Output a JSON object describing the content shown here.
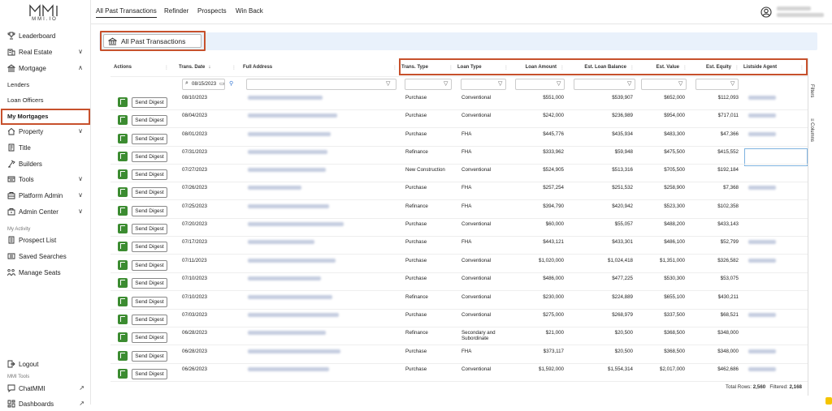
{
  "brand": {
    "logo_text": "MMI.IO"
  },
  "sidebar": {
    "items": [
      {
        "label": "Leaderboard",
        "icon": "trophy-icon",
        "has_chevron": false
      },
      {
        "label": "Real Estate",
        "icon": "building-icon",
        "has_chevron": true,
        "chevron": "∨"
      },
      {
        "label": "Mortgage",
        "icon": "bank-icon",
        "has_chevron": true,
        "chevron": "∧"
      },
      {
        "label": "Lenders",
        "sub": true
      },
      {
        "label": "Loan Officers",
        "sub": true
      },
      {
        "label": "My Mortgages",
        "sub": true,
        "highlighted": true
      },
      {
        "label": "Property",
        "icon": "house-icon",
        "has_chevron": true,
        "chevron": "∨"
      },
      {
        "label": "Title",
        "icon": "title-icon",
        "has_chevron": false
      },
      {
        "label": "Builders",
        "icon": "builders-icon",
        "has_chevron": false
      },
      {
        "label": "Tools",
        "icon": "tools-icon",
        "has_chevron": true,
        "chevron": "∨"
      },
      {
        "label": "Platform Admin",
        "icon": "platform-admin-icon",
        "has_chevron": true,
        "chevron": "∨"
      },
      {
        "label": "Admin Center",
        "icon": "admin-center-icon",
        "has_chevron": true,
        "chevron": "∨"
      }
    ],
    "my_activity_label": "My Activity",
    "activity_items": [
      {
        "label": "Prospect List",
        "icon": "prospect-list-icon"
      },
      {
        "label": "Saved Searches",
        "icon": "saved-searches-icon"
      },
      {
        "label": "Manage Seats",
        "icon": "manage-seats-icon"
      }
    ],
    "logout_label": "Logout",
    "mmi_tools_label": "MMI Tools",
    "tool_items": [
      {
        "label": "ChatMMI",
        "icon": "chat-icon"
      },
      {
        "label": "Dashboards",
        "icon": "dashboard-icon"
      }
    ]
  },
  "topbar": {
    "tabs": [
      "All Past Transactions",
      "Refinder",
      "Prospects",
      "Win Back"
    ],
    "active_tab": 0
  },
  "page": {
    "title": "All Past Transactions"
  },
  "grid": {
    "columns": [
      "Actions",
      "Trans. Date",
      "Full Address",
      "Trans. Type",
      "Loan Type",
      "Loan Amount",
      "Est. Loan Balance",
      "Est. Value",
      "Est. Equity",
      "Listside Agent"
    ],
    "sort_indicator": "↓",
    "date_filter_value": "08/15/2023",
    "send_digest_label": "Send Digest",
    "rows": [
      {
        "date": "08/10/2023",
        "trans_type": "Purchase",
        "loan_type": "Conventional",
        "loan_amount": "$551,000",
        "est_balance": "$539,907",
        "est_value": "$652,000",
        "est_equity": "$112,093",
        "agent": true
      },
      {
        "date": "08/04/2023",
        "trans_type": "Purchase",
        "loan_type": "Conventional",
        "loan_amount": "$242,000",
        "est_balance": "$236,989",
        "est_value": "$954,000",
        "est_equity": "$717,011",
        "agent": true
      },
      {
        "date": "08/01/2023",
        "trans_type": "Purchase",
        "loan_type": "FHA",
        "loan_amount": "$445,776",
        "est_balance": "$435,934",
        "est_value": "$483,300",
        "est_equity": "$47,366",
        "agent": true
      },
      {
        "date": "07/31/2023",
        "trans_type": "Refinance",
        "loan_type": "FHA",
        "loan_amount": "$333,962",
        "est_balance": "$59,948",
        "est_value": "$475,500",
        "est_equity": "$415,552",
        "agent": false
      },
      {
        "date": "07/27/2023",
        "trans_type": "New Construction",
        "loan_type": "Conventional",
        "loan_amount": "$524,905",
        "est_balance": "$513,316",
        "est_value": "$705,500",
        "est_equity": "$192,184",
        "agent": false
      },
      {
        "date": "07/26/2023",
        "trans_type": "Purchase",
        "loan_type": "FHA",
        "loan_amount": "$257,254",
        "est_balance": "$251,532",
        "est_value": "$258,900",
        "est_equity": "$7,368",
        "agent": true
      },
      {
        "date": "07/25/2023",
        "trans_type": "Refinance",
        "loan_type": "FHA",
        "loan_amount": "$394,790",
        "est_balance": "$420,942",
        "est_value": "$523,300",
        "est_equity": "$102,358",
        "agent": false
      },
      {
        "date": "07/20/2023",
        "trans_type": "Purchase",
        "loan_type": "Conventional",
        "loan_amount": "$60,000",
        "est_balance": "$55,057",
        "est_value": "$488,200",
        "est_equity": "$433,143",
        "agent": false
      },
      {
        "date": "07/17/2023",
        "trans_type": "Purchase",
        "loan_type": "FHA",
        "loan_amount": "$443,121",
        "est_balance": "$433,301",
        "est_value": "$486,100",
        "est_equity": "$52,799",
        "agent": true
      },
      {
        "date": "07/11/2023",
        "trans_type": "Purchase",
        "loan_type": "Conventional",
        "loan_amount": "$1,020,000",
        "est_balance": "$1,024,418",
        "est_value": "$1,351,000",
        "est_equity": "$326,582",
        "agent": true
      },
      {
        "date": "07/10/2023",
        "trans_type": "Purchase",
        "loan_type": "Conventional",
        "loan_amount": "$486,000",
        "est_balance": "$477,225",
        "est_value": "$530,300",
        "est_equity": "$53,075",
        "agent": false
      },
      {
        "date": "07/10/2023",
        "trans_type": "Refinance",
        "loan_type": "Conventional",
        "loan_amount": "$230,000",
        "est_balance": "$224,889",
        "est_value": "$655,100",
        "est_equity": "$430,211",
        "agent": false
      },
      {
        "date": "07/03/2023",
        "trans_type": "Purchase",
        "loan_type": "Conventional",
        "loan_amount": "$275,000",
        "est_balance": "$268,979",
        "est_value": "$337,500",
        "est_equity": "$68,521",
        "agent": true
      },
      {
        "date": "06/28/2023",
        "trans_type": "Refinance",
        "loan_type": "Secondary and Subordinate",
        "loan_amount": "$21,000",
        "est_balance": "$20,500",
        "est_value": "$368,500",
        "est_equity": "$348,000",
        "agent": false
      },
      {
        "date": "06/28/2023",
        "trans_type": "Purchase",
        "loan_type": "FHA",
        "loan_amount": "$373,117",
        "est_balance": "$20,500",
        "est_value": "$368,500",
        "est_equity": "$348,000",
        "agent": true
      },
      {
        "date": "06/26/2023",
        "trans_type": "Purchase",
        "loan_type": "Conventional",
        "loan_amount": "$1,592,000",
        "est_balance": "$1,554,314",
        "est_value": "$2,017,000",
        "est_equity": "$462,686",
        "agent": true
      }
    ],
    "side_tabs": [
      "Filters",
      "Columns"
    ],
    "footer": {
      "total_label": "Total Rows:",
      "total": "2,560",
      "filtered_label": "Filtered:",
      "filtered": "2,168"
    }
  },
  "colors": {
    "highlight": "#c7512c",
    "digest_icon": "#3c8c31",
    "banner": "#e9f1fb"
  }
}
